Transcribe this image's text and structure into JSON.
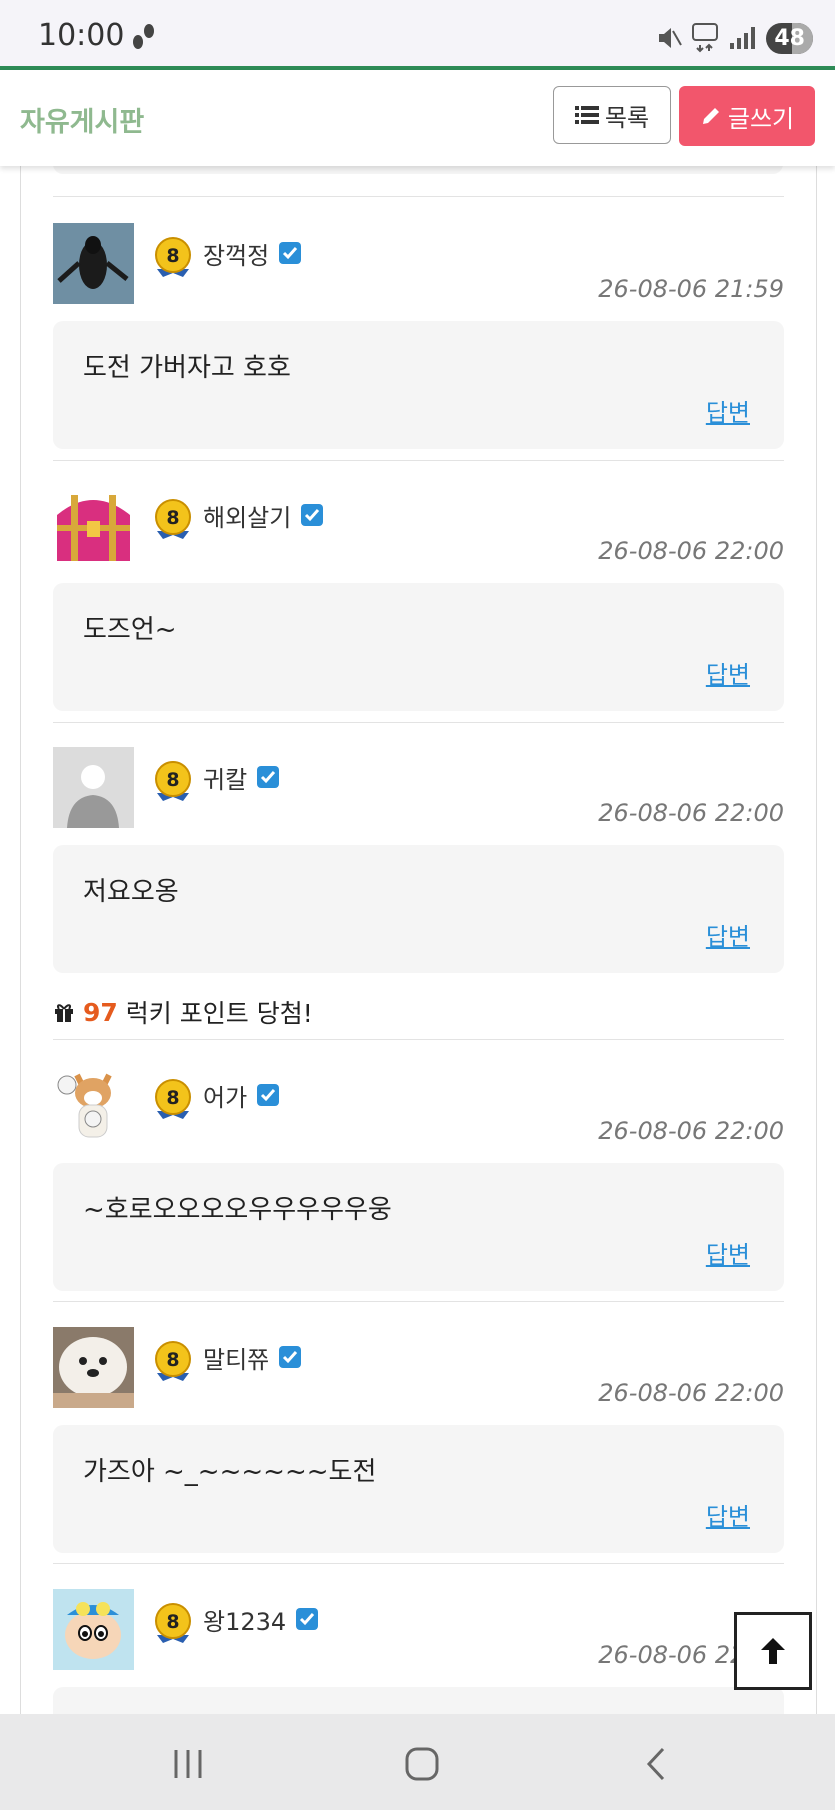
{
  "status_bar": {
    "time": "10:00",
    "battery": "48"
  },
  "header": {
    "title": "자유게시판",
    "list_label": "목록",
    "write_label": "글쓰기"
  },
  "comments": [
    {
      "nick": "장꺽정",
      "level": "8",
      "date": "26-08-06 21:59",
      "text": "도전 가버자고 호호",
      "reply": "답변",
      "avatar": "penguin"
    },
    {
      "nick": "해외살기",
      "level": "8",
      "date": "26-08-06 22:00",
      "text": "도즈언~",
      "reply": "답변",
      "avatar": "treasure-chest"
    },
    {
      "nick": "귀칼",
      "level": "8",
      "date": "26-08-06 22:00",
      "text": "저요오옹",
      "reply": "답변",
      "avatar": "default-person"
    },
    {
      "nick": "어가",
      "level": "8",
      "date": "26-08-06 22:00",
      "text": "~호로오오오오우우우우우웅",
      "reply": "답변",
      "avatar": "shiba-dog"
    },
    {
      "nick": "말티쮸",
      "level": "8",
      "date": "26-08-06 22:00",
      "text": "가즈아 ~_~~~~~~도전",
      "reply": "답변",
      "avatar": "maltese-dog"
    },
    {
      "nick": "왕1234",
      "level": "8",
      "date": "26-08-06 22:00",
      "text": "",
      "reply": "",
      "avatar": "cartoon-boy"
    }
  ],
  "lucky": {
    "points": "97",
    "text": "럭키 포인트 당첨!"
  },
  "colors": {
    "accent_green": "#2e8b57",
    "write_button": "#f2566c",
    "link_blue": "#2a8fd8",
    "lucky_orange": "#e55b1e"
  }
}
